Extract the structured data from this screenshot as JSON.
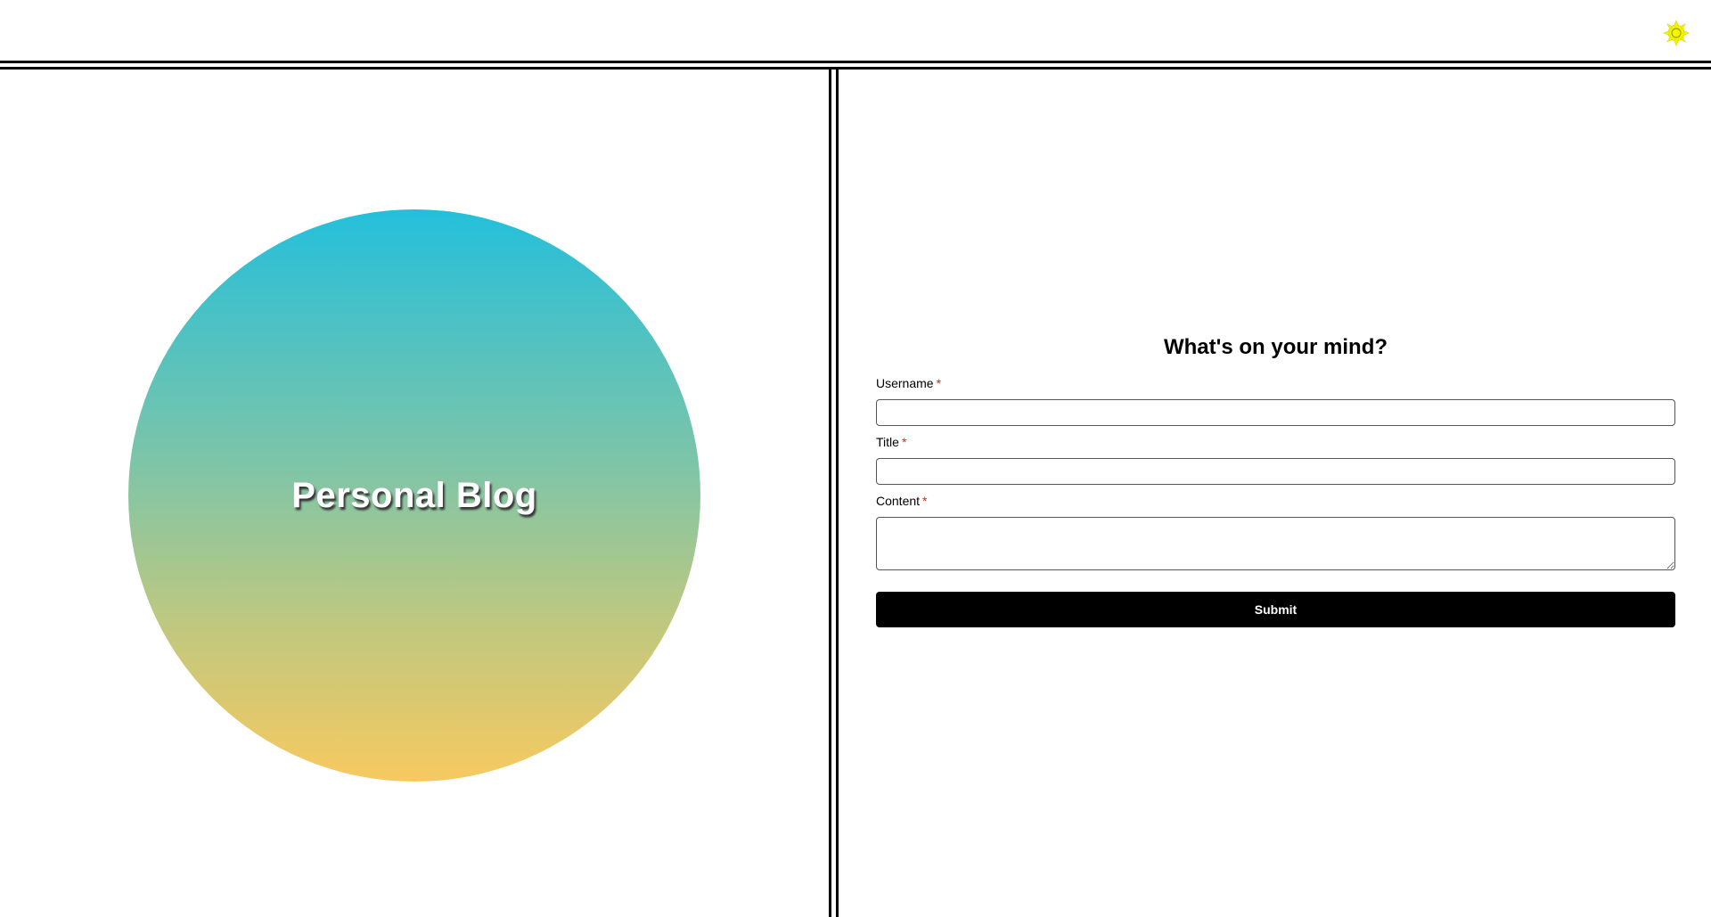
{
  "header": {
    "theme_toggle_icon": "sun-icon",
    "theme_toggle_color": "#f5f500"
  },
  "hero": {
    "title": "Personal Blog",
    "gradient_top": "#24bfdb",
    "gradient_bottom": "#f7c960"
  },
  "form": {
    "heading": "What's on your mind?",
    "required_marker": "*",
    "fields": [
      {
        "label": "Username",
        "value": "",
        "placeholder": ""
      },
      {
        "label": "Title",
        "value": "",
        "placeholder": ""
      },
      {
        "label": "Content",
        "value": "",
        "placeholder": ""
      }
    ],
    "submit_label": "Submit"
  }
}
